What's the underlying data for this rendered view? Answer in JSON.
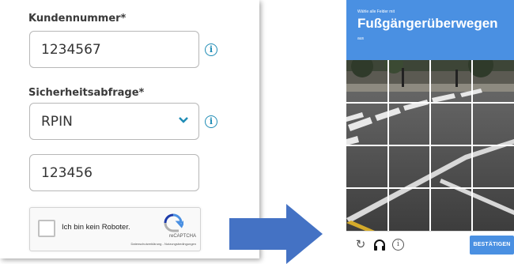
{
  "form": {
    "customer_number_label": "Kundennummer*",
    "customer_number_value": "1234567",
    "security_label": "Sicherheitsabfrage*",
    "security_select_value": "RPIN",
    "security_input_value": "123456",
    "info_glyph": "i"
  },
  "recaptcha": {
    "checkbox_label": "Ich bin kein Roboter.",
    "brand": "reCAPTCHA",
    "links": "Datenschutzerklärung - Nutzungsbedingungen"
  },
  "captcha_challenge": {
    "instruction": "Wähle alle Felder mit",
    "target": "Fußgängerüberwegen",
    "sub": "aus",
    "verify_label": "BESTÄTIGEN"
  },
  "colors": {
    "accent_blue": "#4a90e2",
    "info_blue": "#1f8cb5",
    "arrow_blue": "#4472c4"
  },
  "icons": {
    "reload": "reload-icon",
    "audio": "headphones-icon",
    "info": "info-icon",
    "chevron": "chevron-down-icon"
  }
}
